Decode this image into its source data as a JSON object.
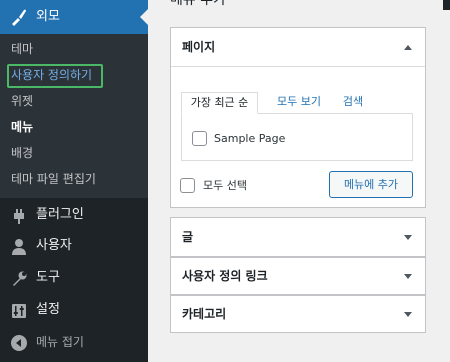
{
  "sidebar": {
    "appearance_label": "외모",
    "submenu": [
      {
        "label": "테마"
      },
      {
        "label": "사용자 정의하기"
      },
      {
        "label": "위젯"
      },
      {
        "label": "메뉴"
      },
      {
        "label": "배경"
      },
      {
        "label": "테마 파일 편집기"
      }
    ],
    "plugins_label": "플러그인",
    "users_label": "사용자",
    "tools_label": "도구",
    "settings_label": "설정",
    "collapse_label": "메뉴 접기"
  },
  "page": {
    "title": "메뉴 추가"
  },
  "pages_box": {
    "title": "페이지",
    "tabs": [
      {
        "label": "가장 최근 순"
      },
      {
        "label": "모두 보기"
      },
      {
        "label": "검색"
      }
    ],
    "item_label": "Sample Page",
    "select_all_label": "모두 선택",
    "add_button_label": "메뉴에 추가"
  },
  "sections": [
    {
      "title": "글"
    },
    {
      "title": "사용자 정의 링크"
    },
    {
      "title": "카테고리"
    }
  ],
  "colors": {
    "admin_bar": "#1d2327",
    "submenu_bg": "#2c3338",
    "accent": "#2271b1",
    "focus": "#4ab866"
  }
}
